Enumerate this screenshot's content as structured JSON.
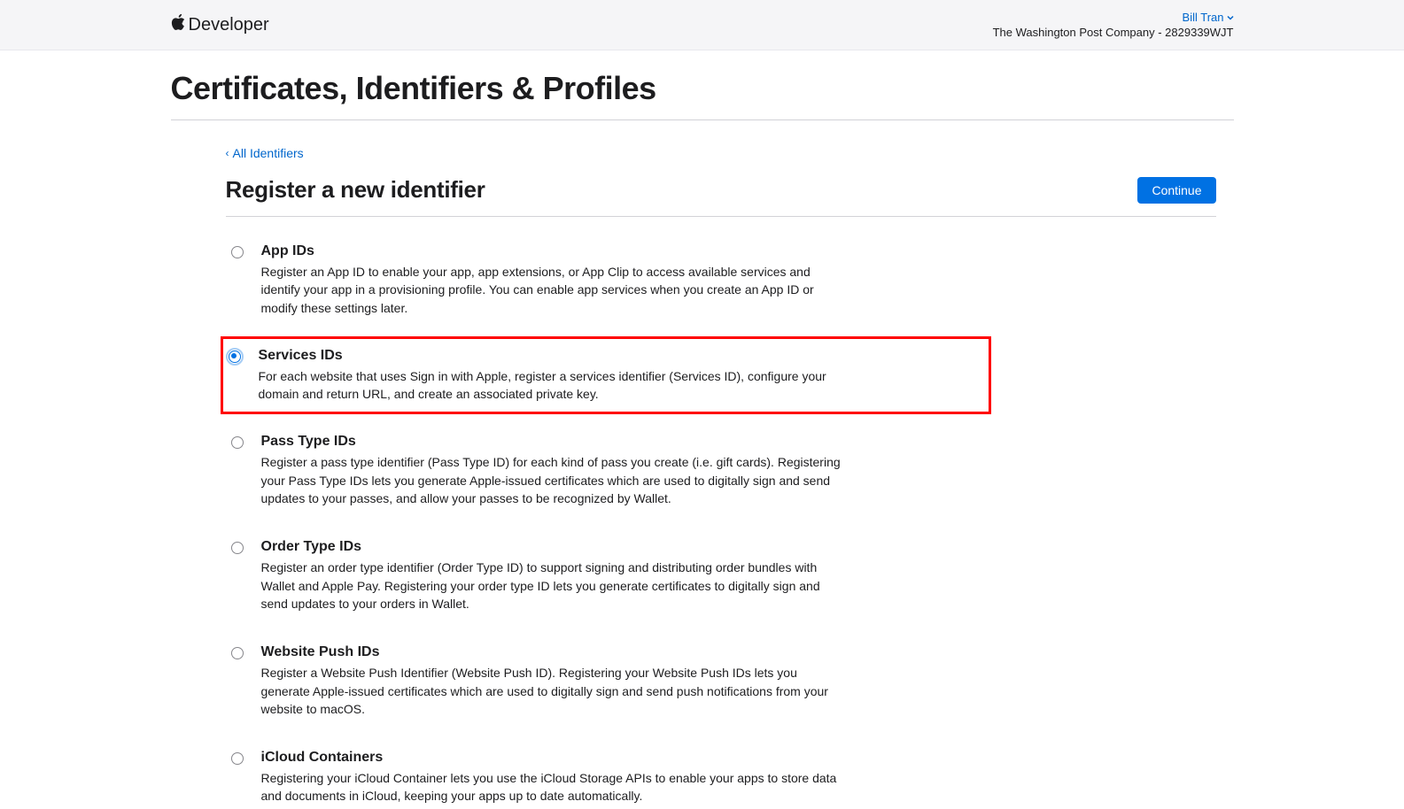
{
  "header": {
    "brand": "Developer",
    "account_name": "Bill Tran",
    "account_org": "The Washington Post Company - 2829339WJT"
  },
  "page": {
    "title": "Certificates, Identifiers & Profiles",
    "breadcrumb_label": "All Identifiers",
    "sub_title": "Register a new identifier",
    "continue_label": "Continue"
  },
  "options": [
    {
      "id": "app-ids",
      "title": "App IDs",
      "description": "Register an App ID to enable your app, app extensions, or App Clip to access available services and identify your app in a provisioning profile. You can enable app services when you create an App ID or modify these settings later.",
      "selected": false,
      "highlight": false
    },
    {
      "id": "services-ids",
      "title": "Services IDs",
      "description": "For each website that uses Sign in with Apple, register a services identifier (Services ID), configure your domain and return URL, and create an associated private key.",
      "selected": true,
      "highlight": true
    },
    {
      "id": "pass-type-ids",
      "title": "Pass Type IDs",
      "description": "Register a pass type identifier (Pass Type ID) for each kind of pass you create (i.e. gift cards). Registering your Pass Type IDs lets you generate Apple-issued certificates which are used to digitally sign and send updates to your passes, and allow your passes to be recognized by Wallet.",
      "selected": false,
      "highlight": false
    },
    {
      "id": "order-type-ids",
      "title": "Order Type IDs",
      "description": "Register an order type identifier (Order Type ID) to support signing and distributing order bundles with Wallet and Apple Pay. Registering your order type ID lets you generate certificates to digitally sign and send updates to your orders in Wallet.",
      "selected": false,
      "highlight": false
    },
    {
      "id": "website-push-ids",
      "title": "Website Push IDs",
      "description": "Register a Website Push Identifier (Website Push ID). Registering your Website Push IDs lets you generate Apple-issued certificates which are used to digitally sign and send push notifications from your website to macOS.",
      "selected": false,
      "highlight": false
    },
    {
      "id": "icloud-containers",
      "title": "iCloud Containers",
      "description": "Registering your iCloud Container lets you use the iCloud Storage APIs to enable your apps to store data and documents in iCloud, keeping your apps up to date automatically.",
      "selected": false,
      "highlight": false
    }
  ]
}
